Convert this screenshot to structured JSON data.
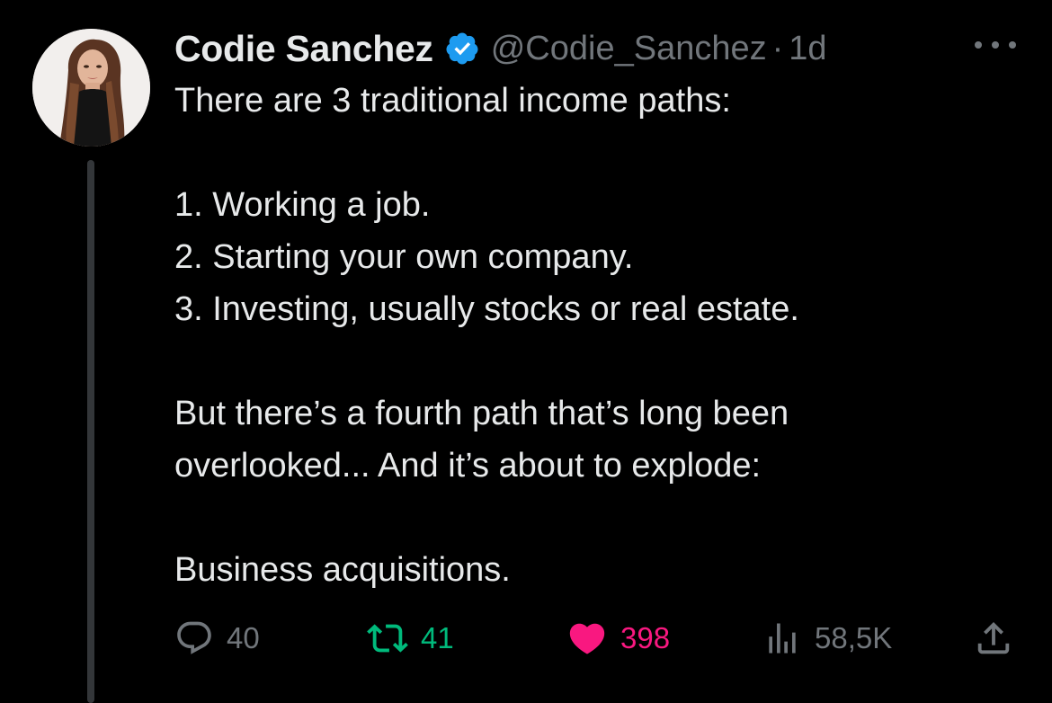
{
  "tweet": {
    "author": {
      "display_name": "Codie Sanchez",
      "handle": "@Codie_Sanchez",
      "verified": true,
      "avatar_icon": "profile-photo"
    },
    "separator": "·",
    "time": "1d",
    "body_lines": [
      "There are 3 traditional income paths:",
      "",
      "1. Working a job.",
      "2. Starting your own company.",
      "3. Investing, usually stocks or real estate.",
      "",
      "But there’s a fourth path that’s long been",
      "overlooked... And it’s about to explode:",
      "",
      "Business acquisitions."
    ],
    "stats": {
      "replies": "40",
      "retweets": "41",
      "likes": "398",
      "views": "58,5K"
    },
    "liked": true
  },
  "icons": {
    "verified": "verified-badge-icon",
    "more": "more-icon",
    "reply": "reply-icon",
    "retweet": "retweet-icon",
    "like": "heart-icon",
    "views": "views-icon",
    "share": "share-icon"
  },
  "colors": {
    "background": "#000000",
    "text": "#e7e9ea",
    "muted": "#71767b",
    "verified": "#1d9bf0",
    "retweet": "#00ba7c",
    "like": "#f91880",
    "thread_line": "#333639"
  }
}
